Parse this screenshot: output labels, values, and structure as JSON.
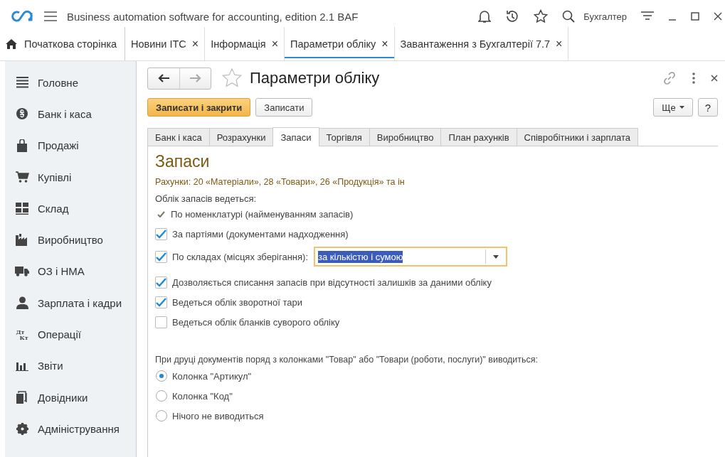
{
  "title_bar": {
    "title": "Business automation software for accounting, edition 2.1 BAF",
    "user": "Бухгалтер"
  },
  "tabs": [
    {
      "label": "Початкова сторінка",
      "kind": "home",
      "selected": false
    },
    {
      "label": "Новини ІТС",
      "kind": "closable",
      "selected": false
    },
    {
      "label": "Інформація",
      "kind": "closable",
      "selected": false
    },
    {
      "label": "Параметри обліку",
      "kind": "closable",
      "selected": true
    },
    {
      "label": "Завантаження з Бухгалтерії 7.7",
      "kind": "closable",
      "selected": false
    }
  ],
  "close_glyph": "×",
  "sidebar": {
    "items": [
      {
        "label": "Головне",
        "kind": "lines"
      },
      {
        "label": "Банк і каса",
        "kind": "coin"
      },
      {
        "label": "Продажі",
        "kind": "bag"
      },
      {
        "label": "Купівлі",
        "kind": "cart"
      },
      {
        "label": "Склад",
        "kind": "grid"
      },
      {
        "label": "Виробництво",
        "kind": "factory"
      },
      {
        "label": "ОЗ і НМА",
        "kind": "truck"
      },
      {
        "label": "Зарплата і кадри",
        "kind": "person"
      },
      {
        "label": "Операції",
        "kind": "dtkt",
        "icon_text": [
          "Дт",
          "Кт"
        ]
      },
      {
        "label": "Звіти",
        "kind": "bars"
      },
      {
        "label": "Довідники",
        "kind": "books"
      },
      {
        "label": "Адміністрування",
        "kind": "gear"
      }
    ]
  },
  "form": {
    "title": "Параметри обліку",
    "buttons": [
      {
        "label": "Записати і закрити",
        "kind": "primary"
      },
      {
        "label": "Записати",
        "kind": "plain"
      }
    ],
    "more": "Ще",
    "help": "?",
    "tabs": [
      {
        "label": "Банк і каса",
        "selected": false
      },
      {
        "label": "Розрахунки",
        "selected": false
      },
      {
        "label": "Запаси",
        "selected": true
      },
      {
        "label": "Торгівля",
        "selected": false
      },
      {
        "label": "Виробництво",
        "selected": false
      },
      {
        "label": "План рахунків",
        "selected": false
      },
      {
        "label": "Співробітники і зарплата",
        "selected": false
      }
    ],
    "section": {
      "heading": "Запаси",
      "accounts": "Рахунки: 20 «Матеріали», 28 «Товари», 26 «Продукція» та ін",
      "accounting_label": "Облік запасів ведеться:",
      "options": [
        {
          "kind": "fixed",
          "label": "По номенклатурі (найменуванням запасів)",
          "checked": true
        },
        {
          "kind": "checkbox",
          "label": "За партіями (документами надходження)",
          "checked": true
        },
        {
          "kind": "checkbox-select",
          "label": "По складах (місцях зберігання):",
          "checked": true,
          "value": "за кількістю і сумою"
        },
        {
          "kind": "checkbox",
          "label": "Дозволяється списання запасів при відсутності залишків за даними обліку",
          "checked": true
        },
        {
          "kind": "checkbox",
          "label": "Ведеться облік зворотної тари",
          "checked": true
        },
        {
          "kind": "checkbox",
          "label": "Ведеться облік бланків суворого обліку",
          "checked": false
        }
      ],
      "print_label": "При друці  документів поряд з колонками \"Товар\" або \"Товари (роботи, послуги)\" виводиться:",
      "print_options": [
        {
          "label": "Колонка \"Артикул\"",
          "selected": true
        },
        {
          "label": "Колонка \"Код\"",
          "selected": false
        },
        {
          "label": "Нічого не виводиться",
          "selected": false
        }
      ]
    }
  }
}
